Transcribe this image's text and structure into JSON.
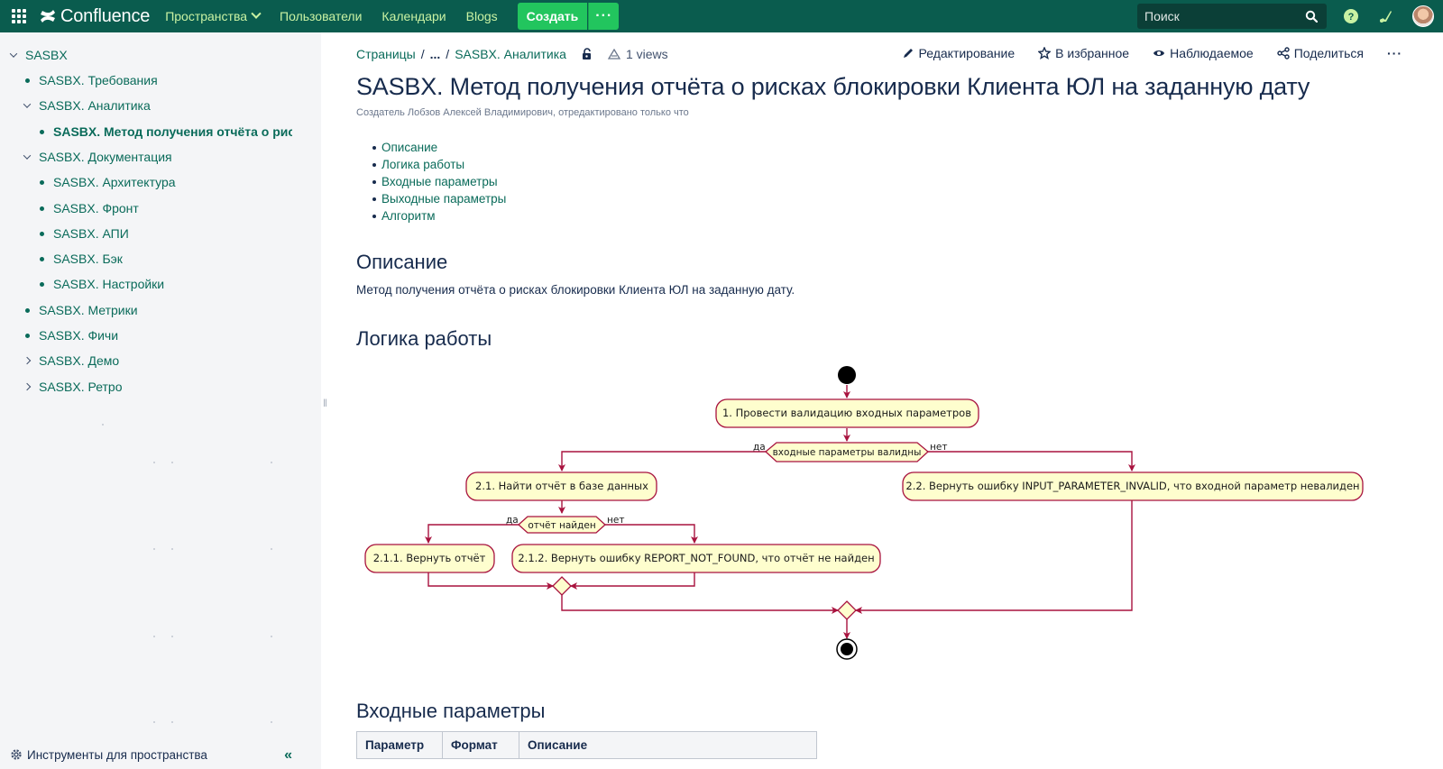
{
  "topbar": {
    "logo_text": "Confluence",
    "nav": [
      {
        "label": "Пространства",
        "has_dropdown": true
      },
      {
        "label": "Пользователи"
      },
      {
        "label": "Календари"
      },
      {
        "label": "Blogs"
      }
    ],
    "create_label": "Создать",
    "more_label": "···",
    "search_placeholder": "Поиск",
    "accent_color": "#0a5c4e",
    "create_color": "#22c55e"
  },
  "sidebar": {
    "items": [
      {
        "label": "SASBX",
        "level": 0,
        "toggle": "down"
      },
      {
        "label": "SASBX. Требования",
        "level": 1,
        "toggle": "bullet"
      },
      {
        "label": "SASBX. Аналитика",
        "level": 1,
        "toggle": "down"
      },
      {
        "label": "SASBX. Метод получения отчёта о рис",
        "level": 2,
        "toggle": "bullet",
        "active": true
      },
      {
        "label": "SASBX. Документация",
        "level": 1,
        "toggle": "down"
      },
      {
        "label": "SASBX. Архитектура",
        "level": 2,
        "toggle": "bullet"
      },
      {
        "label": "SASBX. Фронт",
        "level": 2,
        "toggle": "bullet"
      },
      {
        "label": "SASBX. АПИ",
        "level": 2,
        "toggle": "bullet"
      },
      {
        "label": "SASBX. Бэк",
        "level": 2,
        "toggle": "bullet"
      },
      {
        "label": "SASBX. Настройки",
        "level": 2,
        "toggle": "bullet"
      },
      {
        "label": "SASBX. Метрики",
        "level": 1,
        "toggle": "bullet"
      },
      {
        "label": "SASBX. Фичи",
        "level": 1,
        "toggle": "bullet"
      },
      {
        "label": "SASBX. Демо",
        "level": 1,
        "toggle": "right"
      },
      {
        "label": "SASBX. Ретро",
        "level": 1,
        "toggle": "right"
      }
    ],
    "footer_label": "Инструменты для пространства",
    "collapse_label": "«"
  },
  "breadcrumb": {
    "items": [
      "Страницы",
      "...",
      "SASBX. Аналитика"
    ],
    "views": "1 views"
  },
  "actions": [
    "Редактирование",
    "В избранное",
    "Наблюдаемое",
    "Поделиться"
  ],
  "page": {
    "title": "SASBX. Метод получения отчёта о рисках блокировки Клиента ЮЛ на заданную дату",
    "byline": "Создатель Лобзов Алексей Владимирович, отредактировано только что",
    "toc": [
      "Описание",
      "Логика работы",
      "Входные параметры",
      "Выходные параметры",
      "Алгоритм"
    ],
    "h_description": "Описание",
    "description": "Метод получения отчёта о рисках блокировки Клиента ЮЛ на заданную дату.",
    "h_logic": "Логика работы",
    "h_input": "Входные параметры",
    "table_headers": [
      "Параметр",
      "Формат",
      "Описание"
    ]
  },
  "diagram": {
    "n1": "1. Провести валидацию входных параметров",
    "d1": "входные параметры валидны",
    "d1_yes": "да",
    "d1_no": "нет",
    "n21": "2.1. Найти отчёт в базе данных",
    "n22": "2.2. Вернуть ошибку INPUT_PARAMETER_INVALID, что входной параметр невалиден",
    "d2": "отчёт найден",
    "d2_yes": "да",
    "d2_no": "нет",
    "n211": "2.1.1. Вернуть отчёт",
    "n212": "2.1.2. Вернуть ошибку REPORT_NOT_FOUND, что отчёт не найден"
  }
}
